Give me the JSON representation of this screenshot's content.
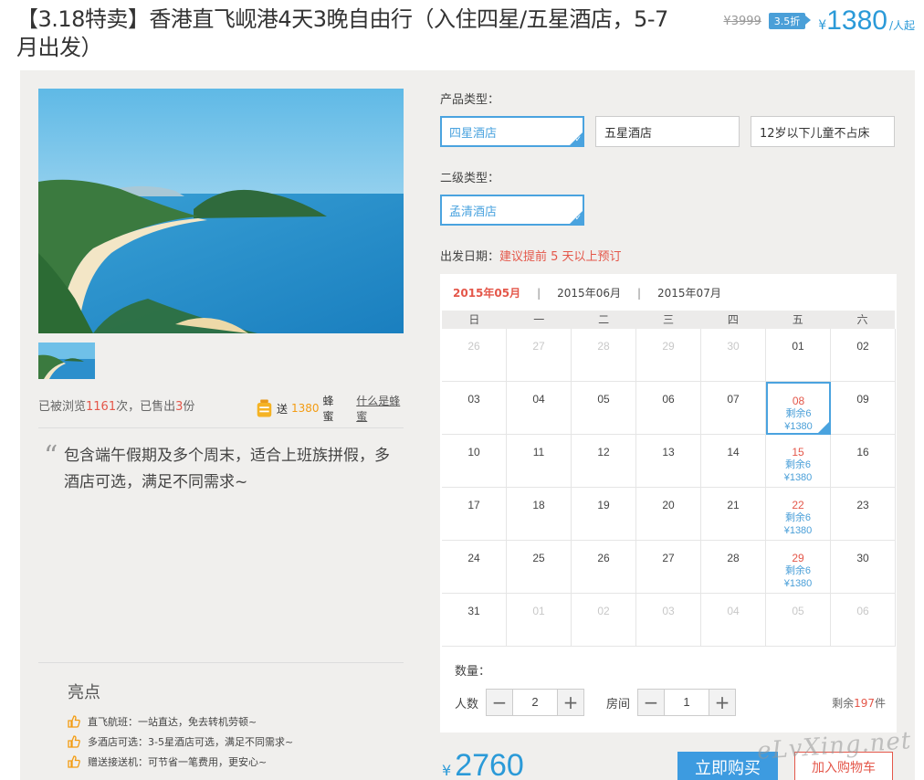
{
  "header": {
    "title": "【3.18特卖】香港直飞岘港4天3晚自由行（入住四星/五星酒店，5-7月出发）",
    "old_price": "¥3999",
    "discount": "3.5折",
    "currency": "¥",
    "price": "1380",
    "price_suffix": "/人起"
  },
  "left": {
    "stats": {
      "prefix": "已被浏览",
      "views": "1161",
      "mid": "次，已售出",
      "sold": "3",
      "suffix": "份"
    },
    "honey": {
      "prefix": "送",
      "amount": "1380",
      "suffix": "蜂蜜",
      "link": "什么是蜂蜜"
    },
    "quote": "包含端午假期及多个周末，适合上班族拼假，多酒店可选，满足不同需求~",
    "highlights_title": "亮点",
    "highlights": [
      "直飞航班：一站直达，免去转机劳顿~",
      "多酒店可选：3-5星酒店可选，满足不同需求~",
      "赠送接送机：可节省一笔费用，更安心~"
    ]
  },
  "right": {
    "product_type_label": "产品类型：",
    "product_types": [
      "四星酒店",
      "五星酒店",
      "12岁以下儿童不占床"
    ],
    "sub_type_label": "二级类型：",
    "sub_types": [
      "孟清酒店"
    ],
    "date_label": "出发日期：",
    "date_hint": "建议提前 5 天以上预订",
    "months": [
      "2015年05月",
      "2015年06月",
      "2015年07月"
    ],
    "weekdays": [
      "日",
      "一",
      "二",
      "三",
      "四",
      "五",
      "六"
    ],
    "calendar": [
      {
        "d": "26",
        "other": true
      },
      {
        "d": "27",
        "other": true
      },
      {
        "d": "28",
        "other": true
      },
      {
        "d": "29",
        "other": true
      },
      {
        "d": "30",
        "other": true
      },
      {
        "d": "01"
      },
      {
        "d": "02"
      },
      {
        "d": "03"
      },
      {
        "d": "04"
      },
      {
        "d": "05"
      },
      {
        "d": "06"
      },
      {
        "d": "07"
      },
      {
        "d": "08",
        "rem": "剩余6",
        "pr": "¥1380",
        "sel": true
      },
      {
        "d": "09"
      },
      {
        "d": "10"
      },
      {
        "d": "11"
      },
      {
        "d": "12"
      },
      {
        "d": "13"
      },
      {
        "d": "14"
      },
      {
        "d": "15",
        "rem": "剩余6",
        "pr": "¥1380"
      },
      {
        "d": "16"
      },
      {
        "d": "17"
      },
      {
        "d": "18"
      },
      {
        "d": "19"
      },
      {
        "d": "20"
      },
      {
        "d": "21"
      },
      {
        "d": "22",
        "rem": "剩余6",
        "pr": "¥1380"
      },
      {
        "d": "23"
      },
      {
        "d": "24"
      },
      {
        "d": "25"
      },
      {
        "d": "26"
      },
      {
        "d": "27"
      },
      {
        "d": "28"
      },
      {
        "d": "29",
        "rem": "剩余6",
        "pr": "¥1380"
      },
      {
        "d": "30"
      },
      {
        "d": "31"
      },
      {
        "d": "01",
        "other": true
      },
      {
        "d": "02",
        "other": true
      },
      {
        "d": "03",
        "other": true
      },
      {
        "d": "04",
        "other": true
      },
      {
        "d": "05",
        "other": true
      },
      {
        "d": "06",
        "other": true
      }
    ],
    "qty_label": "数量：",
    "people_label": "人数",
    "people_value": "2",
    "room_label": "房间",
    "room_value": "1",
    "remain_prefix": "剩余",
    "remain_count": "197",
    "remain_suffix": "件",
    "minus": "−",
    "plus": "+"
  },
  "footer": {
    "currency": "¥",
    "total": "2760",
    "buy_label": "立即购买",
    "cart_label": "加入购物车",
    "watermark": "eLvXing.net"
  },
  "colors": {
    "accent": "#4aa3df",
    "price": "#2b9ad8",
    "highlight": "#e4574a",
    "panel_bg": "#f0efed"
  }
}
